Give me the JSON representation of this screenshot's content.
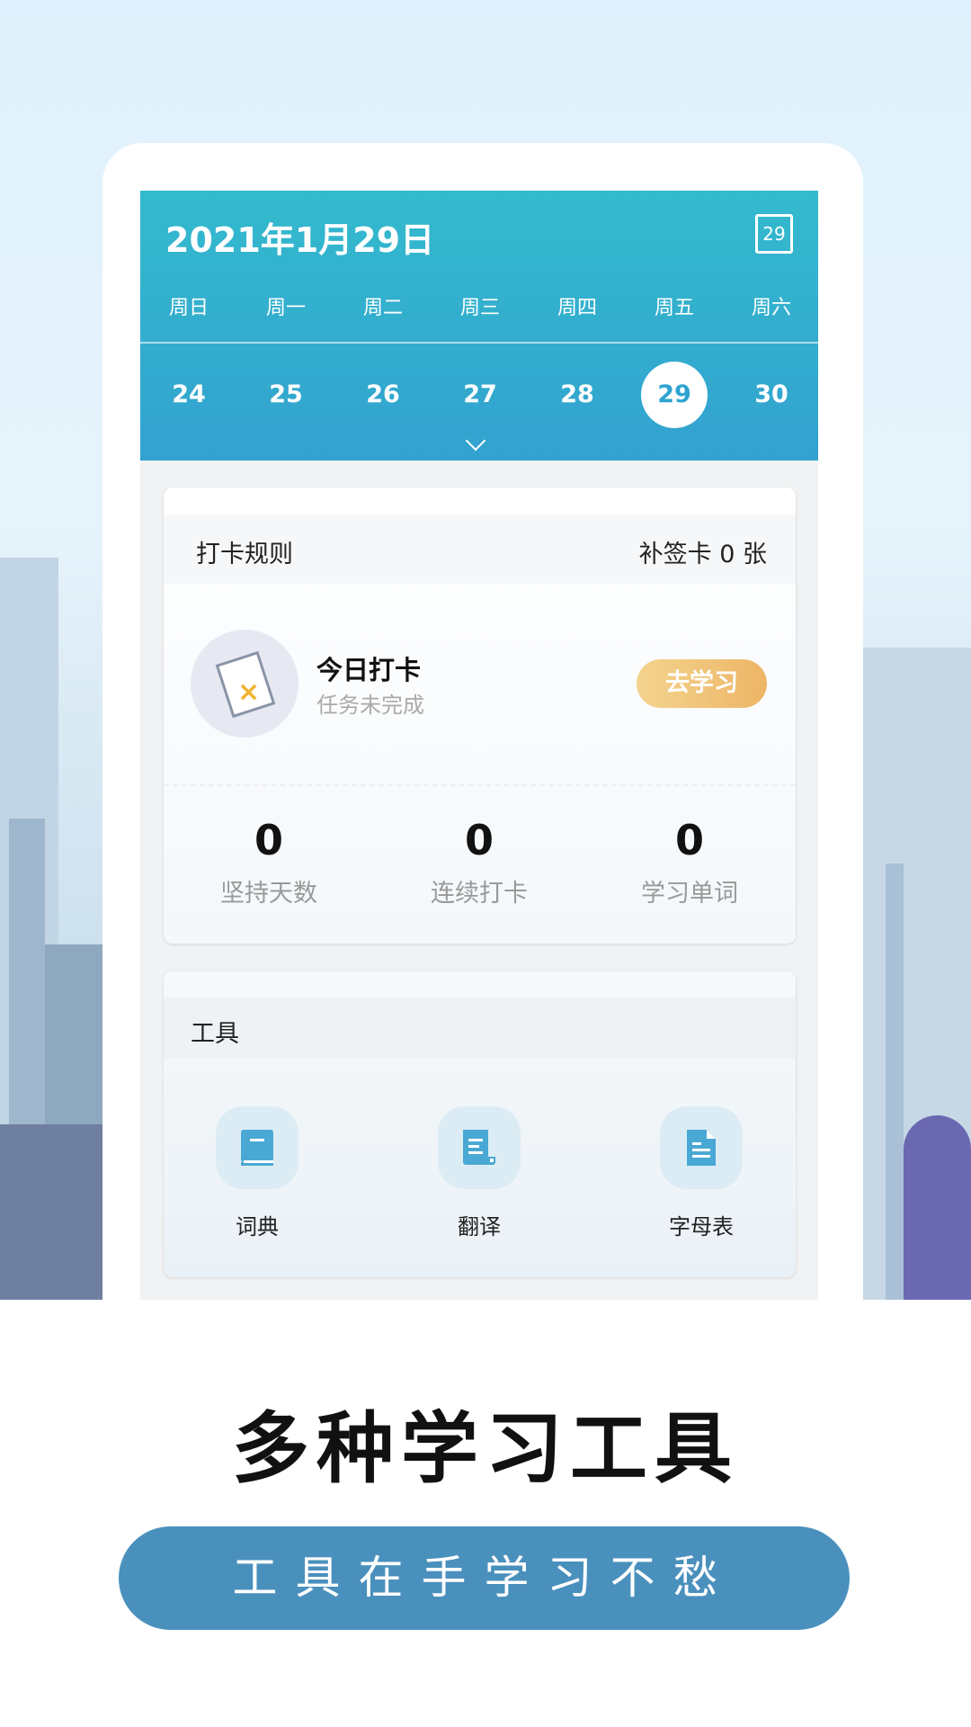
{
  "header": {
    "date": "2021年1月29日",
    "calendar_icon_day": "29",
    "weekdays": [
      "周日",
      "周一",
      "周二",
      "周三",
      "周四",
      "周五",
      "周六"
    ],
    "dates": [
      "24",
      "25",
      "26",
      "27",
      "28",
      "29",
      "30"
    ],
    "selected_date": "29"
  },
  "checkin": {
    "rules_label": "打卡规则",
    "makeup_card": "补签卡 0 张",
    "today_title": "今日打卡",
    "today_status": "任务未完成",
    "go_study": "去学习",
    "stats": [
      {
        "value": "0",
        "label": "坚持天数"
      },
      {
        "value": "0",
        "label": "连续打卡"
      },
      {
        "value": "0",
        "label": "学习单词"
      }
    ]
  },
  "tools": {
    "title": "工具",
    "items": [
      {
        "label": "词典",
        "icon": "book-icon"
      },
      {
        "label": "翻译",
        "icon": "document-icon"
      },
      {
        "label": "字母表",
        "icon": "file-icon"
      }
    ]
  },
  "promo": {
    "title": "多种学习工具",
    "subtitle": "工具在手学习不愁"
  },
  "colors": {
    "header_start": "#33bacd",
    "header_end": "#33a2d0",
    "accent_button": "#edb566",
    "pill": "#4a90bd"
  }
}
